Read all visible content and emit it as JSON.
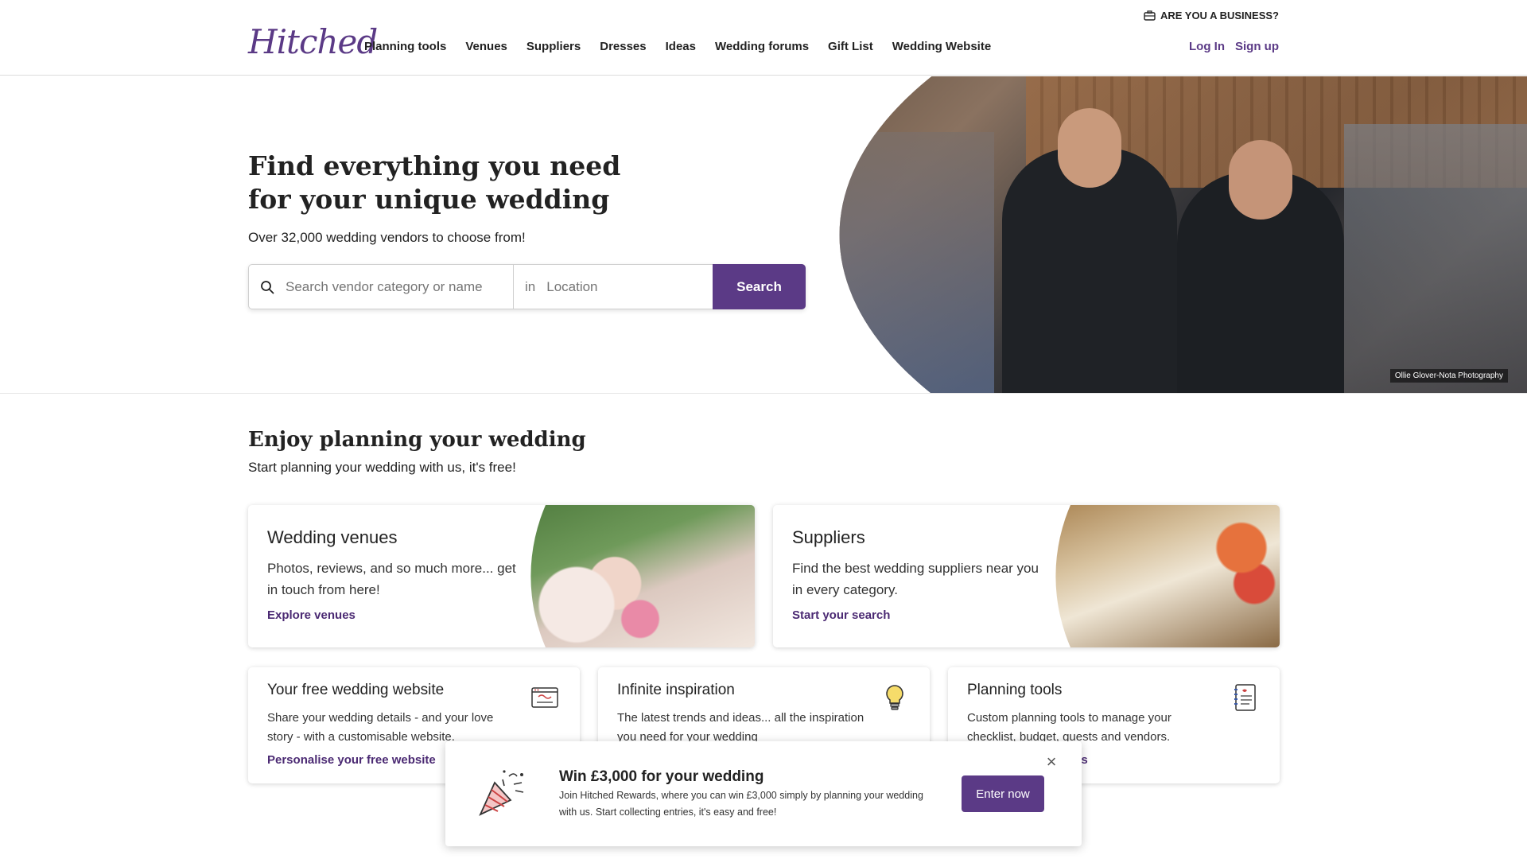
{
  "header": {
    "logo": "Hitched",
    "nav": [
      "Planning tools",
      "Venues",
      "Suppliers",
      "Dresses",
      "Ideas",
      "Wedding forums",
      "Gift List",
      "Wedding Website"
    ],
    "business_link": "ARE YOU A BUSINESS?",
    "login": "Log In",
    "signup": "Sign up"
  },
  "hero": {
    "title": "Find everything you need for your unique wedding",
    "subtitle": "Over 32,000 wedding vendors to choose from!",
    "search_placeholder": "Search vendor category or name",
    "location_prefix": "in",
    "location_placeholder": "Location",
    "search_button": "Search",
    "photo_credit": "Ollie Glover-Nota Photography"
  },
  "planning": {
    "title": "Enjoy planning your wedding",
    "subtitle": "Start planning your wedding with us, it's free!",
    "big_cards": [
      {
        "title": "Wedding venues",
        "desc": "Photos, reviews, and so much more... get in touch from here!",
        "link": "Explore venues"
      },
      {
        "title": "Suppliers",
        "desc": "Find the best wedding suppliers near you in every category.",
        "link": "Start your search"
      }
    ],
    "small_cards": [
      {
        "title": "Your free wedding website",
        "desc": "Share your wedding details - and your love story - with a customisable website.",
        "link": "Personalise your free website",
        "icon": "website-icon"
      },
      {
        "title": "Infinite inspiration",
        "desc": "The latest trends and ideas... all the inspiration you need for your wedding",
        "link": "",
        "icon": "lightbulb-icon"
      },
      {
        "title": "Planning tools",
        "desc": "Custom planning tools to manage your checklist, budget, guests and vendors.",
        "link": "ols",
        "icon": "notebook-icon"
      }
    ]
  },
  "popup": {
    "title": "Win £3,000 for your wedding",
    "desc": "Join Hitched Rewards, where you can win £3,000 simply by planning your wedding with us. Start collecting entries, it's easy and free!",
    "button": "Enter now",
    "close": "×"
  },
  "colors": {
    "brand": "#5b3a86",
    "link": "#4b2a73"
  }
}
